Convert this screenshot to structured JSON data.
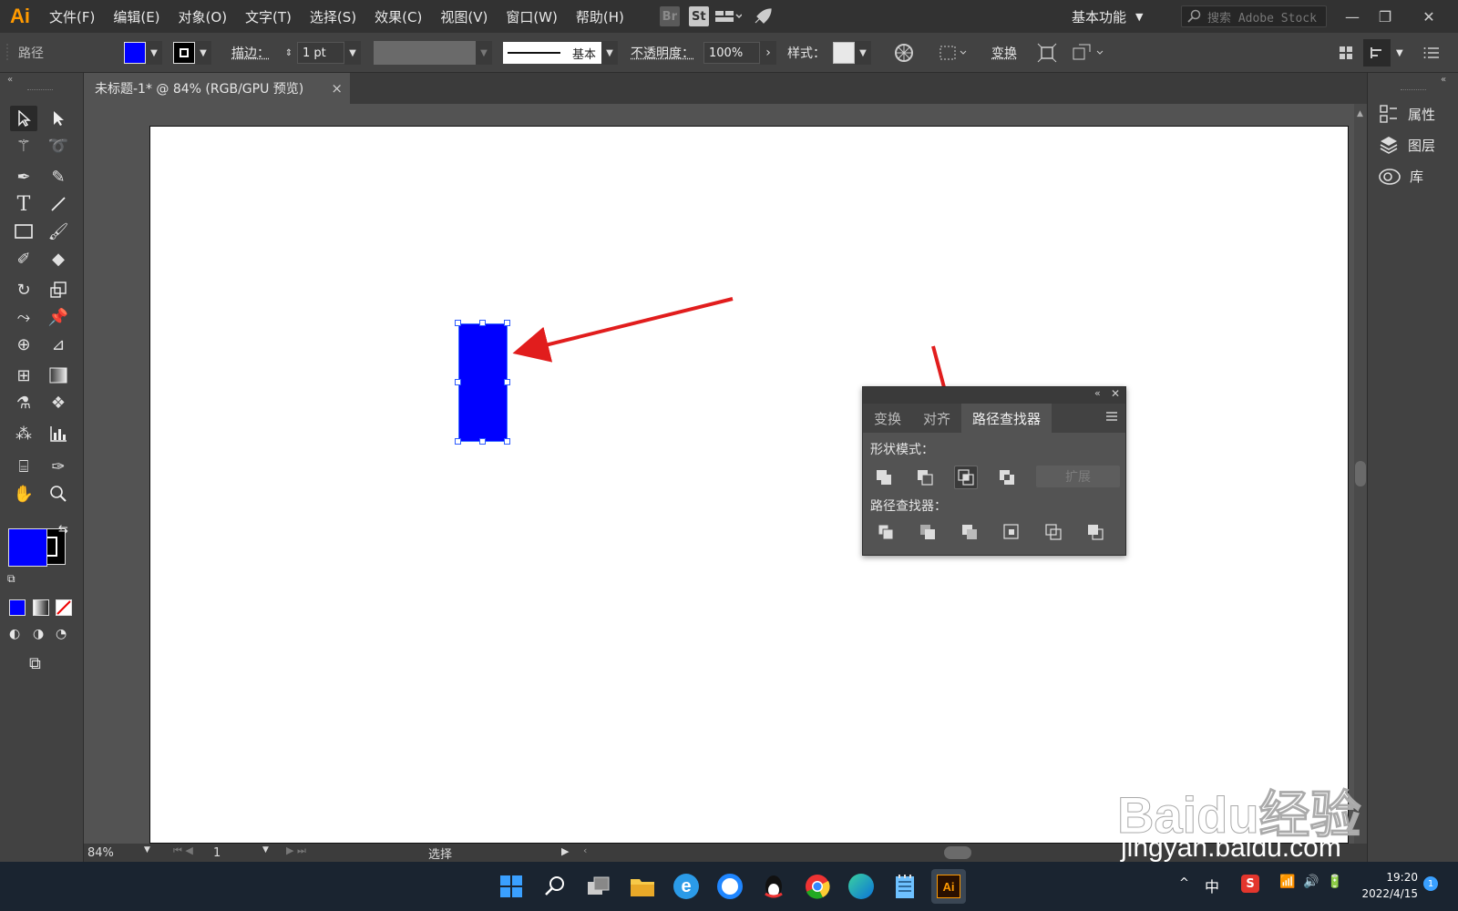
{
  "app": {
    "logo": "Ai"
  },
  "menu": [
    "文件(F)",
    "编辑(E)",
    "对象(O)",
    "文字(T)",
    "选择(S)",
    "效果(C)",
    "视图(V)",
    "窗口(W)",
    "帮助(H)"
  ],
  "menubar_badges": {
    "bridge": "Br",
    "stock": "St"
  },
  "workspace": "基本功能",
  "search": {
    "placeholder": "搜索 Adobe Stock"
  },
  "control_bar": {
    "selection_type": "路径",
    "fill_color": "#0000ff",
    "stroke_label": "描边：",
    "stroke_weight": "1 pt",
    "profile_label": "基本",
    "opacity_label": "不透明度：",
    "opacity_value": "100%",
    "style_label": "样式：",
    "transform_label": "变换"
  },
  "document_tab": {
    "title": "未标题-1* @ 84% (RGB/GPU 预览)",
    "close": "×"
  },
  "right_dock": [
    {
      "icon": "properties-icon",
      "label": "属性"
    },
    {
      "icon": "layers-icon",
      "label": "图层"
    },
    {
      "icon": "libraries-icon",
      "label": "库"
    }
  ],
  "status_bar": {
    "zoom": "84%",
    "artboard": "1",
    "tool": "选择"
  },
  "pathfinder_panel": {
    "tabs": [
      "变换",
      "对齐",
      "路径查找器"
    ],
    "active_tab": "路径查找器",
    "shape_modes_label": "形状模式：",
    "pathfinders_label": "路径查找器：",
    "expand_label": "扩展"
  },
  "canvas": {
    "shape_color": "#0000ff",
    "arrow_color": "#e11d1d"
  },
  "taskbar": {
    "ime": "中",
    "time": "19:20",
    "date": "2022/4/15",
    "notif_count": "1"
  },
  "watermark": {
    "brand": "Baidu经验",
    "url": "jingyan.baidu.com"
  }
}
